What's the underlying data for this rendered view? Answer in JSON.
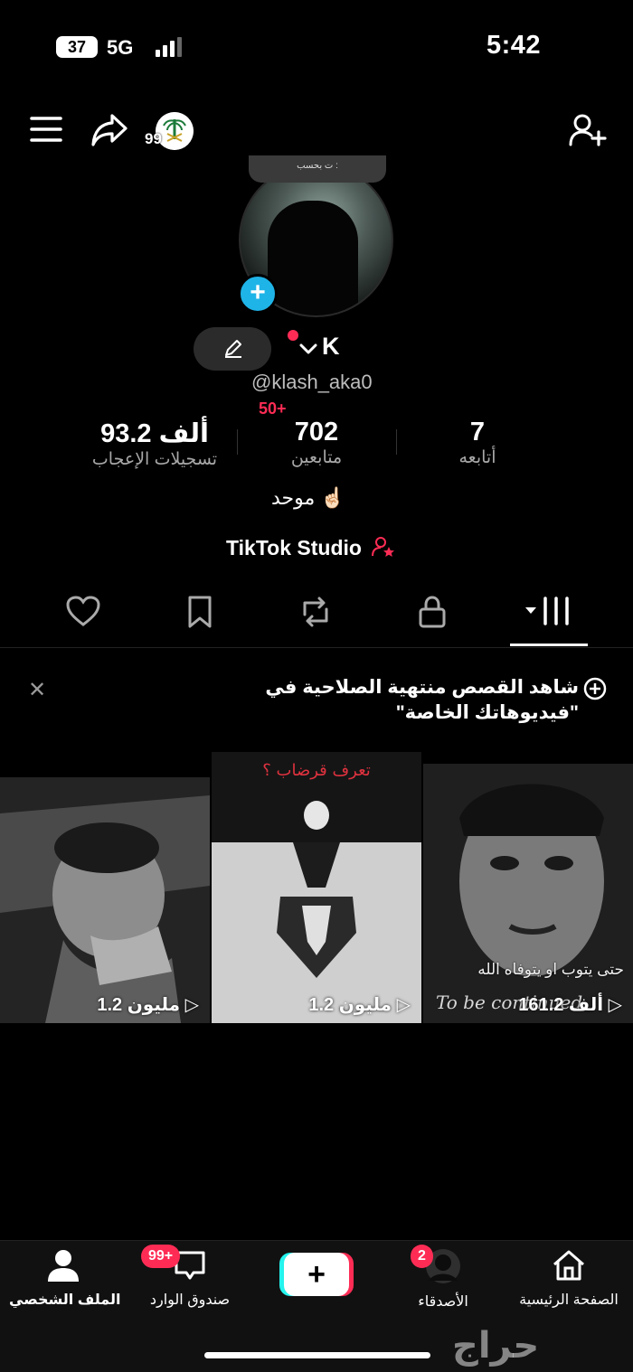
{
  "status_bar": {
    "battery": "37",
    "network": "5G",
    "time": "5:42"
  },
  "header": {
    "badge_count": "99"
  },
  "profile": {
    "avatar_tag": "ت بحسب :",
    "name": "K",
    "handle": "@klash_aka0",
    "new_followers_badge": "50+",
    "stats": {
      "following": {
        "value": "7",
        "label": "أتابعه"
      },
      "followers": {
        "value": "702",
        "label": "متابعين"
      },
      "likes": {
        "value": "93.2 ألف",
        "label": "تسجيلات الإعجاب"
      }
    },
    "bio": "موحد ☝🏻",
    "studio_link": "TikTok Studio"
  },
  "tabs": [
    "videos",
    "private",
    "reposts",
    "favorites",
    "liked"
  ],
  "notice": {
    "text": "شاهد القصص منتهية الصلاحية في \"فيديوهاتك الخاصة\""
  },
  "videos": [
    {
      "views": "1.2 مليون"
    },
    {
      "views": "1.2 مليون",
      "overlay_text": "تعرف قرضاب ؟"
    },
    {
      "views": "161.2 ألف",
      "overlay_text": "حتى يتوب او يتوفاه الله",
      "overlay_text_2": "To be continued"
    }
  ],
  "bottom_nav": {
    "home": "الصفحة الرئيسية",
    "friends": "الأصدقاء",
    "friends_badge": "2",
    "create": "+",
    "inbox": "صندوق الوارد",
    "inbox_badge": "99+",
    "profile": "الملف الشخصي"
  },
  "watermark": "حراج",
  "colors": {
    "accent": "#fe2c55",
    "add_button": "#1fb4e8",
    "background": "#000000"
  }
}
